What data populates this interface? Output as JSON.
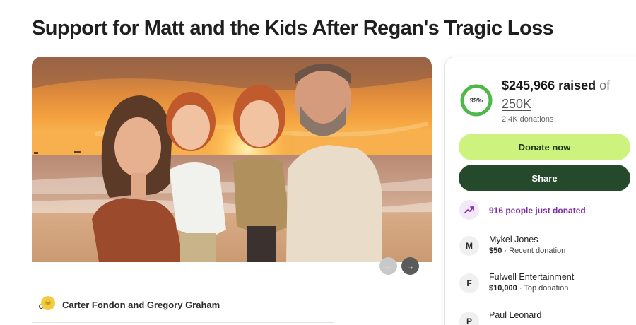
{
  "page": {
    "title": "Support for Matt and the Kids After Regan's Tragic Loss"
  },
  "hero": {
    "image": "family-on-beach-at-sunset-photo",
    "prev_icon": "←",
    "next_icon": "→"
  },
  "organizer": {
    "avatar_letter": "C",
    "secondary_avatar_icon": "☠",
    "name": "Carter Fondon and Gregory Graham"
  },
  "donation_card": {
    "progress_percent": 99,
    "progress_label": "99%",
    "amount_raised": "$245,966 raised",
    "of_label": "of",
    "goal": "250K",
    "donation_count": "2.4K donations",
    "donate_label": "Donate now",
    "share_label": "Share",
    "recent_activity": "916 people just donated",
    "donors": [
      {
        "initial": "M",
        "name": "Mykel Jones",
        "amount": "$50",
        "note": " · Recent donation"
      },
      {
        "initial": "F",
        "name": "Fulwell Entertainment",
        "amount": "$10,000",
        "note": " · Top donation"
      },
      {
        "initial": "P",
        "name": "Paul Leonard",
        "amount": "",
        "note": ""
      }
    ]
  },
  "colors": {
    "accent_green": "#cdf37e",
    "share_green": "#244a2b",
    "progress_green": "#4fb84a",
    "trend_purple": "#7d2ea8"
  }
}
